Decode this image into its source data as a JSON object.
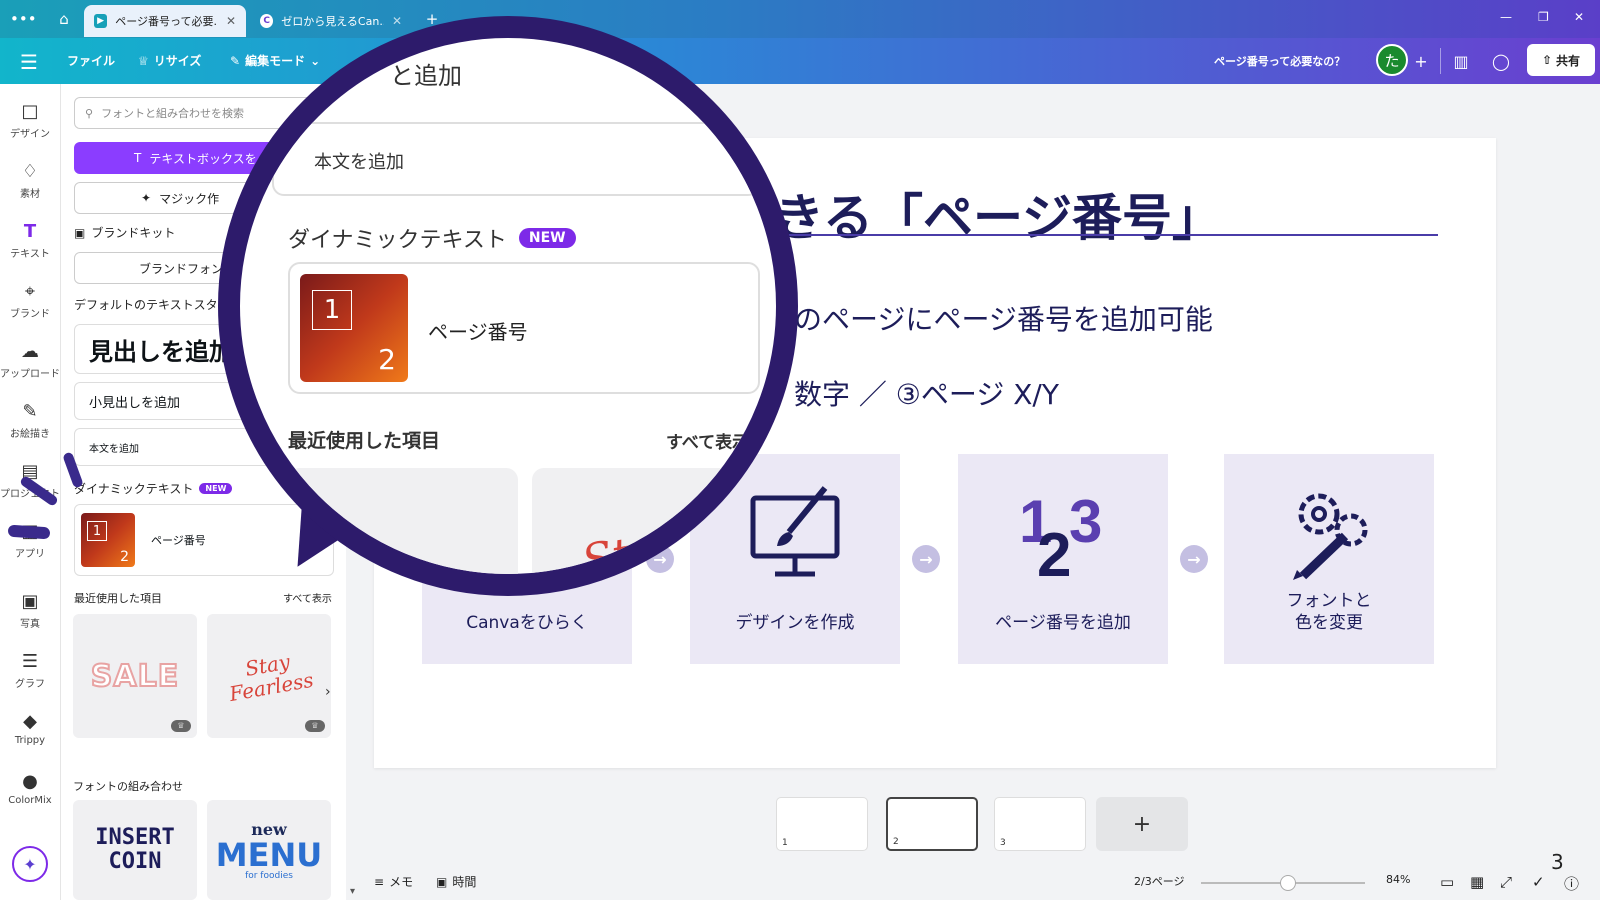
{
  "browser": {
    "tabs": [
      {
        "title": "ページ番号って必要..."
      },
      {
        "title": "ゼロから見えるCan..."
      }
    ],
    "new_tab": "+",
    "more": "•••",
    "win_min": "—",
    "win_max": "❐",
    "win_close": "✕"
  },
  "header": {
    "file": "ファイル",
    "resize": "リサイズ",
    "edit_mode": "編集モード",
    "doc_title": "ページ番号って必要なの？",
    "avatar": "た",
    "share": "共有"
  },
  "rail": [
    {
      "label": "デザイン",
      "icon": "□"
    },
    {
      "label": "素材",
      "icon": "♢"
    },
    {
      "label": "テキスト",
      "icon": "T"
    },
    {
      "label": "ブランド",
      "icon": "⌖"
    },
    {
      "label": "アップロード",
      "icon": "☁"
    },
    {
      "label": "お絵描き",
      "icon": "✎"
    },
    {
      "label": "プロジェクト",
      "icon": "▤"
    },
    {
      "label": "アプリ",
      "icon": "▦"
    },
    {
      "label": "写真",
      "icon": "▣"
    },
    {
      "label": "グラフ",
      "icon": "☰"
    },
    {
      "label": "Trippy",
      "icon": "◆"
    },
    {
      "label": "ColorMix",
      "icon": "●"
    }
  ],
  "panel": {
    "search_placeholder": "フォントと組み合わせを検索",
    "add_textbox": "テキストボックスを",
    "magic": "マジック作",
    "brand_kit": "ブランドキット",
    "brand_font": "ブランドフォン",
    "default_styles": "デフォルトのテキストスタイ",
    "heading": "見出しを追加",
    "subheading": "小見出しを追加",
    "body": "本文を追加",
    "dynamic_text": "ダイナミックテキスト",
    "new": "NEW",
    "page_number": "ページ番号",
    "recent": "最近使用した項目",
    "show_all": "すべて表示",
    "font_combos": "フォントの組み合わせ",
    "thumb_one": "1",
    "thumb_two": "2",
    "sale": "SALE",
    "stay": "Stay",
    "fearless": "Fearless",
    "insert": "INSERT",
    "coin": "COIN",
    "menu_new": "new",
    "menu": "MENU",
    "for_foodies": "for foodies"
  },
  "slide": {
    "title": "きる「ページ番号」",
    "line1": "のページにページ番号を追加可能",
    "line2": "数字 ／ ③ページ X/Y",
    "steps": [
      {
        "label": "Canvaをひらく"
      },
      {
        "label": "デザインを作成"
      },
      {
        "label": "ページ番号を追加"
      },
      {
        "label": "フォントと\n色を変更"
      }
    ]
  },
  "lens": {
    "body": "本文を追加",
    "add_top": "と追加",
    "dynamic_text": "ダイナミックテキスト",
    "new": "NEW",
    "page_number": "ページ番号",
    "recent": "最近使用した項目",
    "show_all": "すべて表示",
    "stay": "Stay",
    "fearless": "Fe"
  },
  "footer": {
    "pages": [
      "1",
      "2",
      "3"
    ],
    "memo": "メモ",
    "time": "時間",
    "page_indicator": "2/3ページ",
    "zoom": "84%",
    "corner": "3"
  }
}
